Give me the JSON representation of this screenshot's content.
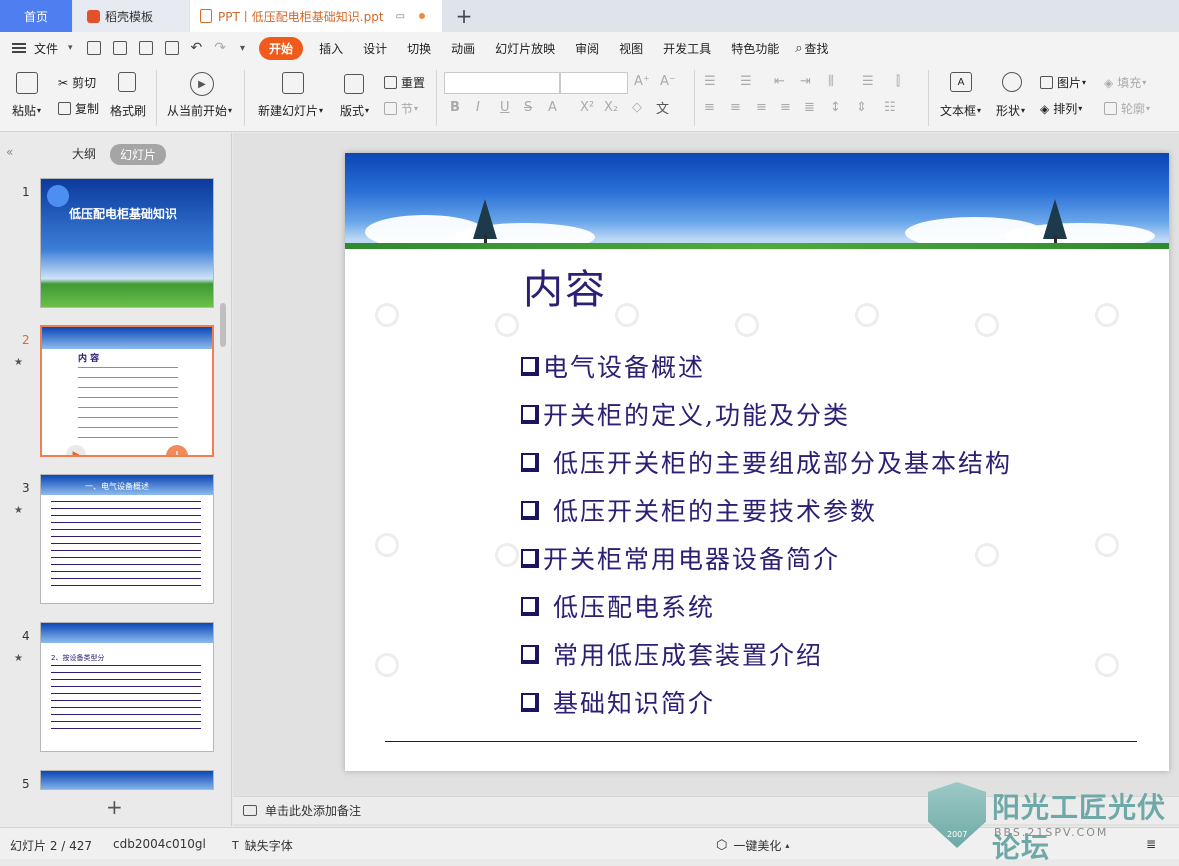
{
  "tabs": {
    "home": "首页",
    "template": "稻壳模板",
    "document": "PPT丨低压配电柜基础知识.ppt"
  },
  "menu": {
    "file": "文件",
    "items": [
      "开始",
      "插入",
      "设计",
      "切换",
      "动画",
      "幻灯片放映",
      "审阅",
      "视图",
      "开发工具",
      "特色功能"
    ],
    "search": "查找"
  },
  "ribbon": {
    "paste": "粘贴",
    "cut": "剪切",
    "copy": "复制",
    "format_painter": "格式刷",
    "play_from_current": "从当前开始",
    "new_slide": "新建幻灯片",
    "layout": "版式",
    "reset": "重置",
    "section": "节",
    "textbox": "文本框",
    "shape": "形状",
    "picture": "图片",
    "fill": "填充",
    "arrange": "排列",
    "outline": "轮廓"
  },
  "left_panel": {
    "outline_tab": "大纲",
    "slides_tab": "幻灯片",
    "thumbnails": [
      {
        "num": "1",
        "title": "低压配电柜基础知识"
      },
      {
        "num": "2",
        "title": "内 容"
      },
      {
        "num": "3",
        "title": "一、电气设备概述"
      },
      {
        "num": "4",
        "title": "2、按设备类型分"
      },
      {
        "num": "5",
        "title": ""
      }
    ]
  },
  "slide": {
    "title": "内容",
    "bullets": [
      "电气设备概述",
      "开关柜的定义,功能及分类",
      " 低压开关柜的主要组成部分及基本结构",
      " 低压开关柜的主要技术参数",
      "开关柜常用电器设备简介",
      " 低压配电系统",
      " 常用低压成套装置介绍",
      " 基础知识简介"
    ]
  },
  "notes": {
    "placeholder": "单击此处添加备注"
  },
  "status": {
    "slide_counter": "幻灯片 2 / 427",
    "theme": "cdb2004c010gl",
    "missing_font": "缺失字体",
    "beautify": "一键美化"
  },
  "watermark": {
    "name": "阳光工匠光伏论坛",
    "url": "BBS.21SPV.COM",
    "year": "2007"
  },
  "colors": {
    "accent": "#f05a1a",
    "slide_text": "#2b2073",
    "home_tab": "#4e7ef0"
  }
}
